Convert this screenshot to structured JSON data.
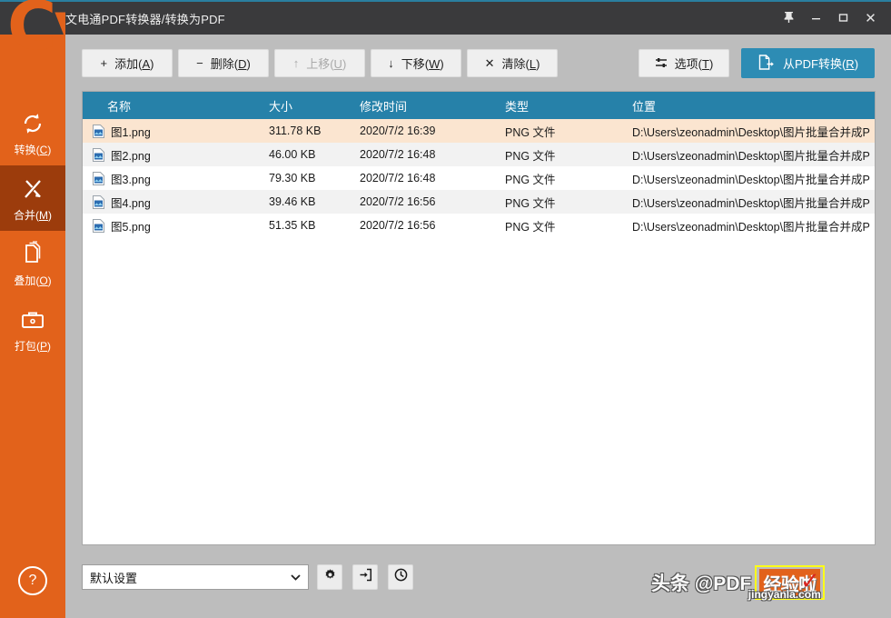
{
  "window": {
    "title": "文电通PDF转换器/转换为PDF",
    "controls": {
      "pin": "pin-icon",
      "minimize": "minimize-icon",
      "maximize": "maximize-icon",
      "close": "close-icon"
    }
  },
  "logo": {
    "text": "Cv"
  },
  "sidebar": {
    "items": [
      {
        "label_prefix": "转换(",
        "key": "C",
        "label_suffix": ")",
        "icon": "convert-icon",
        "active": false
      },
      {
        "label_prefix": "合并(",
        "key": "M",
        "label_suffix": ")",
        "icon": "merge-icon",
        "active": true
      },
      {
        "label_prefix": "叠加(",
        "key": "O",
        "label_suffix": ")",
        "icon": "overlay-icon",
        "active": false
      },
      {
        "label_prefix": "打包(",
        "key": "P",
        "label_suffix": ")",
        "icon": "package-icon",
        "active": false
      }
    ],
    "help": "?"
  },
  "toolbar": {
    "buttons": [
      {
        "glyph": "+",
        "label_prefix": "添加(",
        "key": "A",
        "label_suffix": ")",
        "disabled": false,
        "name": "add-button"
      },
      {
        "glyph": "−",
        "label_prefix": "删除(",
        "key": "D",
        "label_suffix": ")",
        "disabled": false,
        "name": "remove-button"
      },
      {
        "glyph": "↑",
        "label_prefix": "上移(",
        "key": "U",
        "label_suffix": ")",
        "disabled": true,
        "name": "move-up-button"
      },
      {
        "glyph": "↓",
        "label_prefix": "下移(",
        "key": "W",
        "label_suffix": ")",
        "disabled": false,
        "name": "move-down-button"
      },
      {
        "glyph": "✕",
        "label_prefix": "清除(",
        "key": "L",
        "label_suffix": ")",
        "disabled": false,
        "name": "clear-button"
      }
    ],
    "options": {
      "label_prefix": "选项(",
      "key": "T",
      "label_suffix": ")"
    },
    "primary": {
      "label_prefix": "从PDF转换(",
      "key": "R",
      "label_suffix": ")"
    }
  },
  "table": {
    "columns": [
      "名称",
      "大小",
      "修改时间",
      "类型",
      "位置"
    ],
    "rows": [
      {
        "name": "图1.png",
        "size": "311.78 KB",
        "modified": "2020/7/2 16:39",
        "type": "PNG 文件",
        "location": "D:\\Users\\zeonadmin\\Desktop\\图片批量合并成P"
      },
      {
        "name": "图2.png",
        "size": "46.00 KB",
        "modified": "2020/7/2 16:48",
        "type": "PNG 文件",
        "location": "D:\\Users\\zeonadmin\\Desktop\\图片批量合并成P"
      },
      {
        "name": "图3.png",
        "size": "79.30 KB",
        "modified": "2020/7/2 16:48",
        "type": "PNG 文件",
        "location": "D:\\Users\\zeonadmin\\Desktop\\图片批量合并成P"
      },
      {
        "name": "图4.png",
        "size": "39.46 KB",
        "modified": "2020/7/2 16:56",
        "type": "PNG 文件",
        "location": "D:\\Users\\zeonadmin\\Desktop\\图片批量合并成P"
      },
      {
        "name": "图5.png",
        "size": "51.35 KB",
        "modified": "2020/7/2 16:56",
        "type": "PNG 文件",
        "location": "D:\\Users\\zeonadmin\\Desktop\\图片批量合并成P"
      }
    ]
  },
  "bottom": {
    "preset_value": "默认设置",
    "icons": [
      {
        "name": "settings-gear-icon"
      },
      {
        "name": "import-settings-icon"
      },
      {
        "name": "history-clock-icon"
      }
    ]
  },
  "watermark": {
    "toutiao": "头条 @PDF",
    "brand": "经验啦",
    "site": "jingyanla.com"
  },
  "colors": {
    "brand_orange": "#e2621b",
    "brand_orange_active": "#9c3c0c",
    "accent_blue": "#2681a9",
    "primary_button": "#2d8cb4",
    "selected_row": "#fbe5d0",
    "titlebar": "#3a3a3c",
    "watermark_border": "#fdfd17"
  }
}
